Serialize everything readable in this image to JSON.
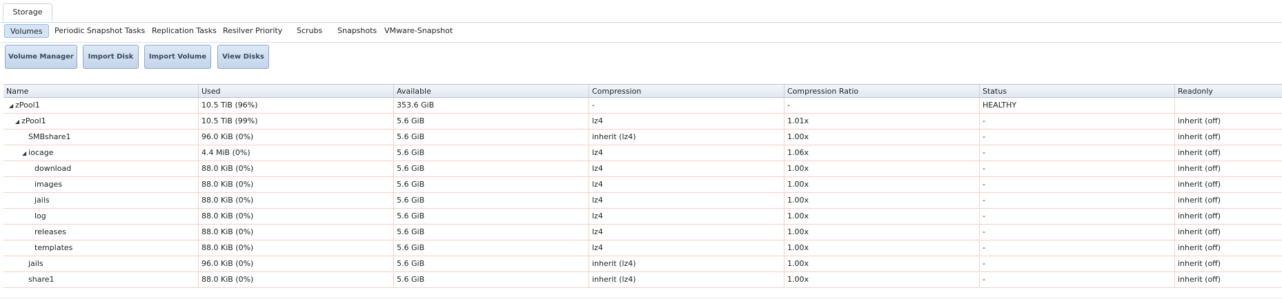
{
  "top_tabs": [
    "Storage"
  ],
  "sub_tabs": [
    "Volumes",
    "Periodic Snapshot Tasks",
    "Replication Tasks",
    "Resilver Priority",
    "Scrubs",
    "Snapshots",
    "VMware-Snapshot"
  ],
  "toolbar": {
    "volume_manager": "Volume Manager",
    "import_disk": "Import Disk",
    "import_volume": "Import Volume",
    "view_disks": "View Disks"
  },
  "columns": [
    "Name",
    "Used",
    "Available",
    "Compression",
    "Compression Ratio",
    "Status",
    "Readonly"
  ],
  "rows": [
    {
      "name": "zPool1",
      "toggle": "◢",
      "used": "10.5 TiB (96%)",
      "available": "353.6 GiB",
      "compression": "-",
      "ratio": "-",
      "status": "HEALTHY",
      "readonly": ""
    },
    {
      "name": "zPool1",
      "toggle": "◢",
      "used": "10.5 TiB (99%)",
      "available": "5.6 GiB",
      "compression": "lz4",
      "ratio": "1.01x",
      "status": "-",
      "readonly": "inherit (off)"
    },
    {
      "name": "SMBshare1",
      "toggle": "",
      "used": "96.0 KiB (0%)",
      "available": "5.6 GiB",
      "compression": "inherit (lz4)",
      "ratio": "1.00x",
      "status": "-",
      "readonly": "inherit (off)"
    },
    {
      "name": "iocage",
      "toggle": "◢",
      "used": "4.4 MiB (0%)",
      "available": "5.6 GiB",
      "compression": "lz4",
      "ratio": "1.06x",
      "status": "-",
      "readonly": "inherit (off)"
    },
    {
      "name": "download",
      "toggle": "",
      "used": "88.0 KiB (0%)",
      "available": "5.6 GiB",
      "compression": "lz4",
      "ratio": "1.00x",
      "status": "-",
      "readonly": "inherit (off)"
    },
    {
      "name": "images",
      "toggle": "",
      "used": "88.0 KiB (0%)",
      "available": "5.6 GiB",
      "compression": "lz4",
      "ratio": "1.00x",
      "status": "-",
      "readonly": "inherit (off)"
    },
    {
      "name": "jails",
      "toggle": "",
      "used": "88.0 KiB (0%)",
      "available": "5.6 GiB",
      "compression": "lz4",
      "ratio": "1.00x",
      "status": "-",
      "readonly": "inherit (off)"
    },
    {
      "name": "log",
      "toggle": "",
      "used": "88.0 KiB (0%)",
      "available": "5.6 GiB",
      "compression": "lz4",
      "ratio": "1.00x",
      "status": "-",
      "readonly": "inherit (off)"
    },
    {
      "name": "releases",
      "toggle": "",
      "used": "88.0 KiB (0%)",
      "available": "5.6 GiB",
      "compression": "lz4",
      "ratio": "1.00x",
      "status": "-",
      "readonly": "inherit (off)"
    },
    {
      "name": "templates",
      "toggle": "",
      "used": "88.0 KiB (0%)",
      "available": "5.6 GiB",
      "compression": "lz4",
      "ratio": "1.00x",
      "status": "-",
      "readonly": "inherit (off)"
    },
    {
      "name": "jails",
      "toggle": "",
      "used": "96.0 KiB (0%)",
      "available": "5.6 GiB",
      "compression": "inherit (lz4)",
      "ratio": "1.00x",
      "status": "-",
      "readonly": "inherit (off)"
    },
    {
      "name": "share1",
      "toggle": "",
      "used": "88.0 KiB (0%)",
      "available": "5.6 GiB",
      "compression": "inherit (lz4)",
      "ratio": "1.00x",
      "status": "-",
      "readonly": "inherit (off)"
    }
  ]
}
